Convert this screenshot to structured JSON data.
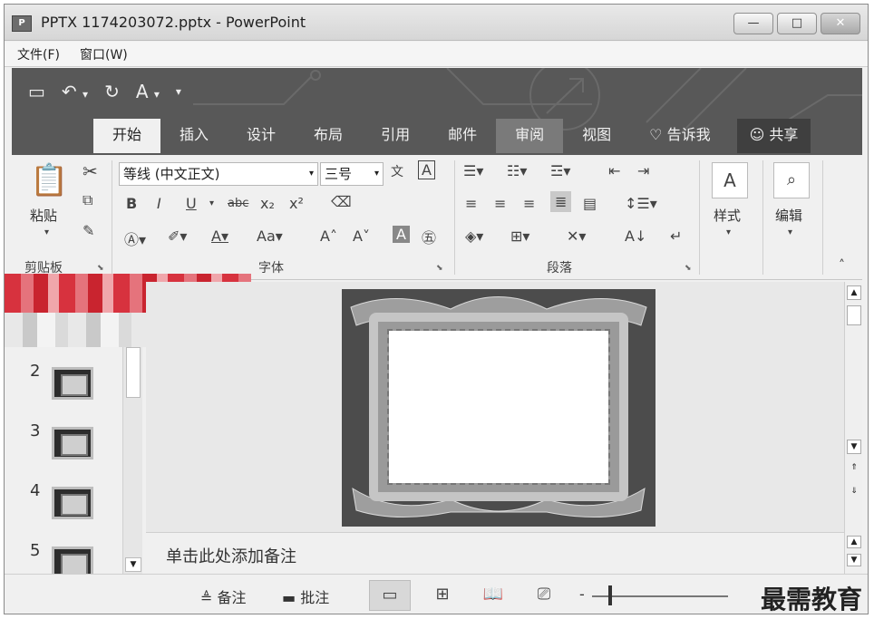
{
  "window": {
    "title": "PPTX 1174203072.pptx - PowerPoint",
    "app_icon": "P",
    "minimize": "—",
    "maximize": "□",
    "close": "✕"
  },
  "menu": {
    "file": "文件(F)",
    "window": "窗口(W)"
  },
  "tabs": [
    {
      "label": "开始"
    },
    {
      "label": "插入"
    },
    {
      "label": "设计"
    },
    {
      "label": "布局"
    },
    {
      "label": "引用"
    },
    {
      "label": "邮件"
    },
    {
      "label": "审阅"
    },
    {
      "label": "视图"
    },
    {
      "label": "告诉我"
    },
    {
      "label": "共享"
    }
  ],
  "ribbon": {
    "clipboard": {
      "paste": "粘贴",
      "label": "剪贴板"
    },
    "font": {
      "name": "等线 (中文正文)",
      "size": "三号",
      "case_btn": "Aa",
      "label": "字体"
    },
    "paragraph": {
      "label": "段落"
    },
    "styles": {
      "label": "样式"
    },
    "editing": {
      "label": "编辑"
    }
  },
  "thumbnails": [
    {
      "num": "2"
    },
    {
      "num": "3"
    },
    {
      "num": "4"
    },
    {
      "num": "5"
    }
  ],
  "notes": {
    "placeholder": "单击此处添加备注"
  },
  "status": {
    "notes_btn": "备注",
    "comments_btn": "批注"
  },
  "watermark": "最需教育"
}
